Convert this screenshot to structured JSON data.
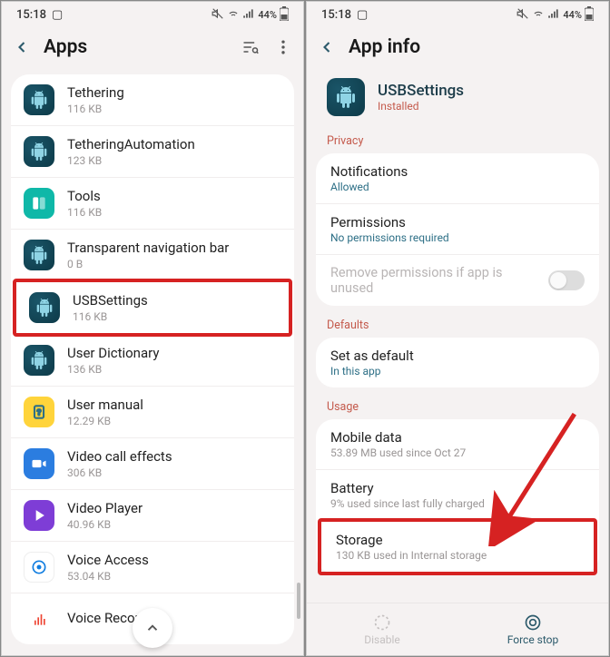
{
  "status": {
    "time": "15:18",
    "battery": "44%",
    "mute": "silent",
    "wifi": "on",
    "signal": "on",
    "icon_left": "picture"
  },
  "left": {
    "title": "Apps",
    "apps": [
      {
        "name": "Tethering",
        "sub": "116 KB",
        "iconClass": "icon-globe"
      },
      {
        "name": "TetheringAutomation",
        "sub": "123 KB",
        "iconClass": "icon-globe"
      },
      {
        "name": "Tools",
        "sub": "116 KB",
        "iconClass": "icon-tools"
      },
      {
        "name": "Transparent navigation bar",
        "sub": "0 B",
        "iconClass": "icon-globe"
      },
      {
        "name": "USBSettings",
        "sub": "116 KB",
        "iconClass": "icon-globe",
        "highlighted": true
      },
      {
        "name": "User Dictionary",
        "sub": "136 KB",
        "iconClass": "icon-globe"
      },
      {
        "name": "User manual",
        "sub": "12.29 KB",
        "iconClass": "icon-usermanual"
      },
      {
        "name": "Video call effects",
        "sub": "306 KB",
        "iconClass": "icon-videocall"
      },
      {
        "name": "Video Player",
        "sub": "40.96 KB",
        "iconClass": "icon-videoplayer"
      },
      {
        "name": "Voice Access",
        "sub": "53.04 KB",
        "iconClass": "icon-voice"
      },
      {
        "name": "Voice Recorder",
        "sub": "",
        "iconClass": "icon-recorder"
      }
    ]
  },
  "right": {
    "title": "App info",
    "app": {
      "name": "USBSettings",
      "status": "Installed"
    },
    "sections": {
      "privacy": {
        "label": "Privacy",
        "items": [
          {
            "title": "Notifications",
            "sub": "Allowed"
          },
          {
            "title": "Permissions",
            "sub": "No permissions required"
          }
        ],
        "remove_unused": "Remove permissions if app is unused"
      },
      "defaults": {
        "label": "Defaults",
        "items": [
          {
            "title": "Set as default",
            "sub": "In this app"
          }
        ]
      },
      "usage": {
        "label": "Usage",
        "items": [
          {
            "title": "Mobile data",
            "sub": "53.89 MB used since Oct 27"
          },
          {
            "title": "Battery",
            "sub": "9% used since last fully charged"
          },
          {
            "title": "Storage",
            "sub": "130 KB used in Internal storage",
            "highlighted": true
          }
        ]
      }
    },
    "bottom": {
      "disable": "Disable",
      "force_stop": "Force stop"
    }
  }
}
